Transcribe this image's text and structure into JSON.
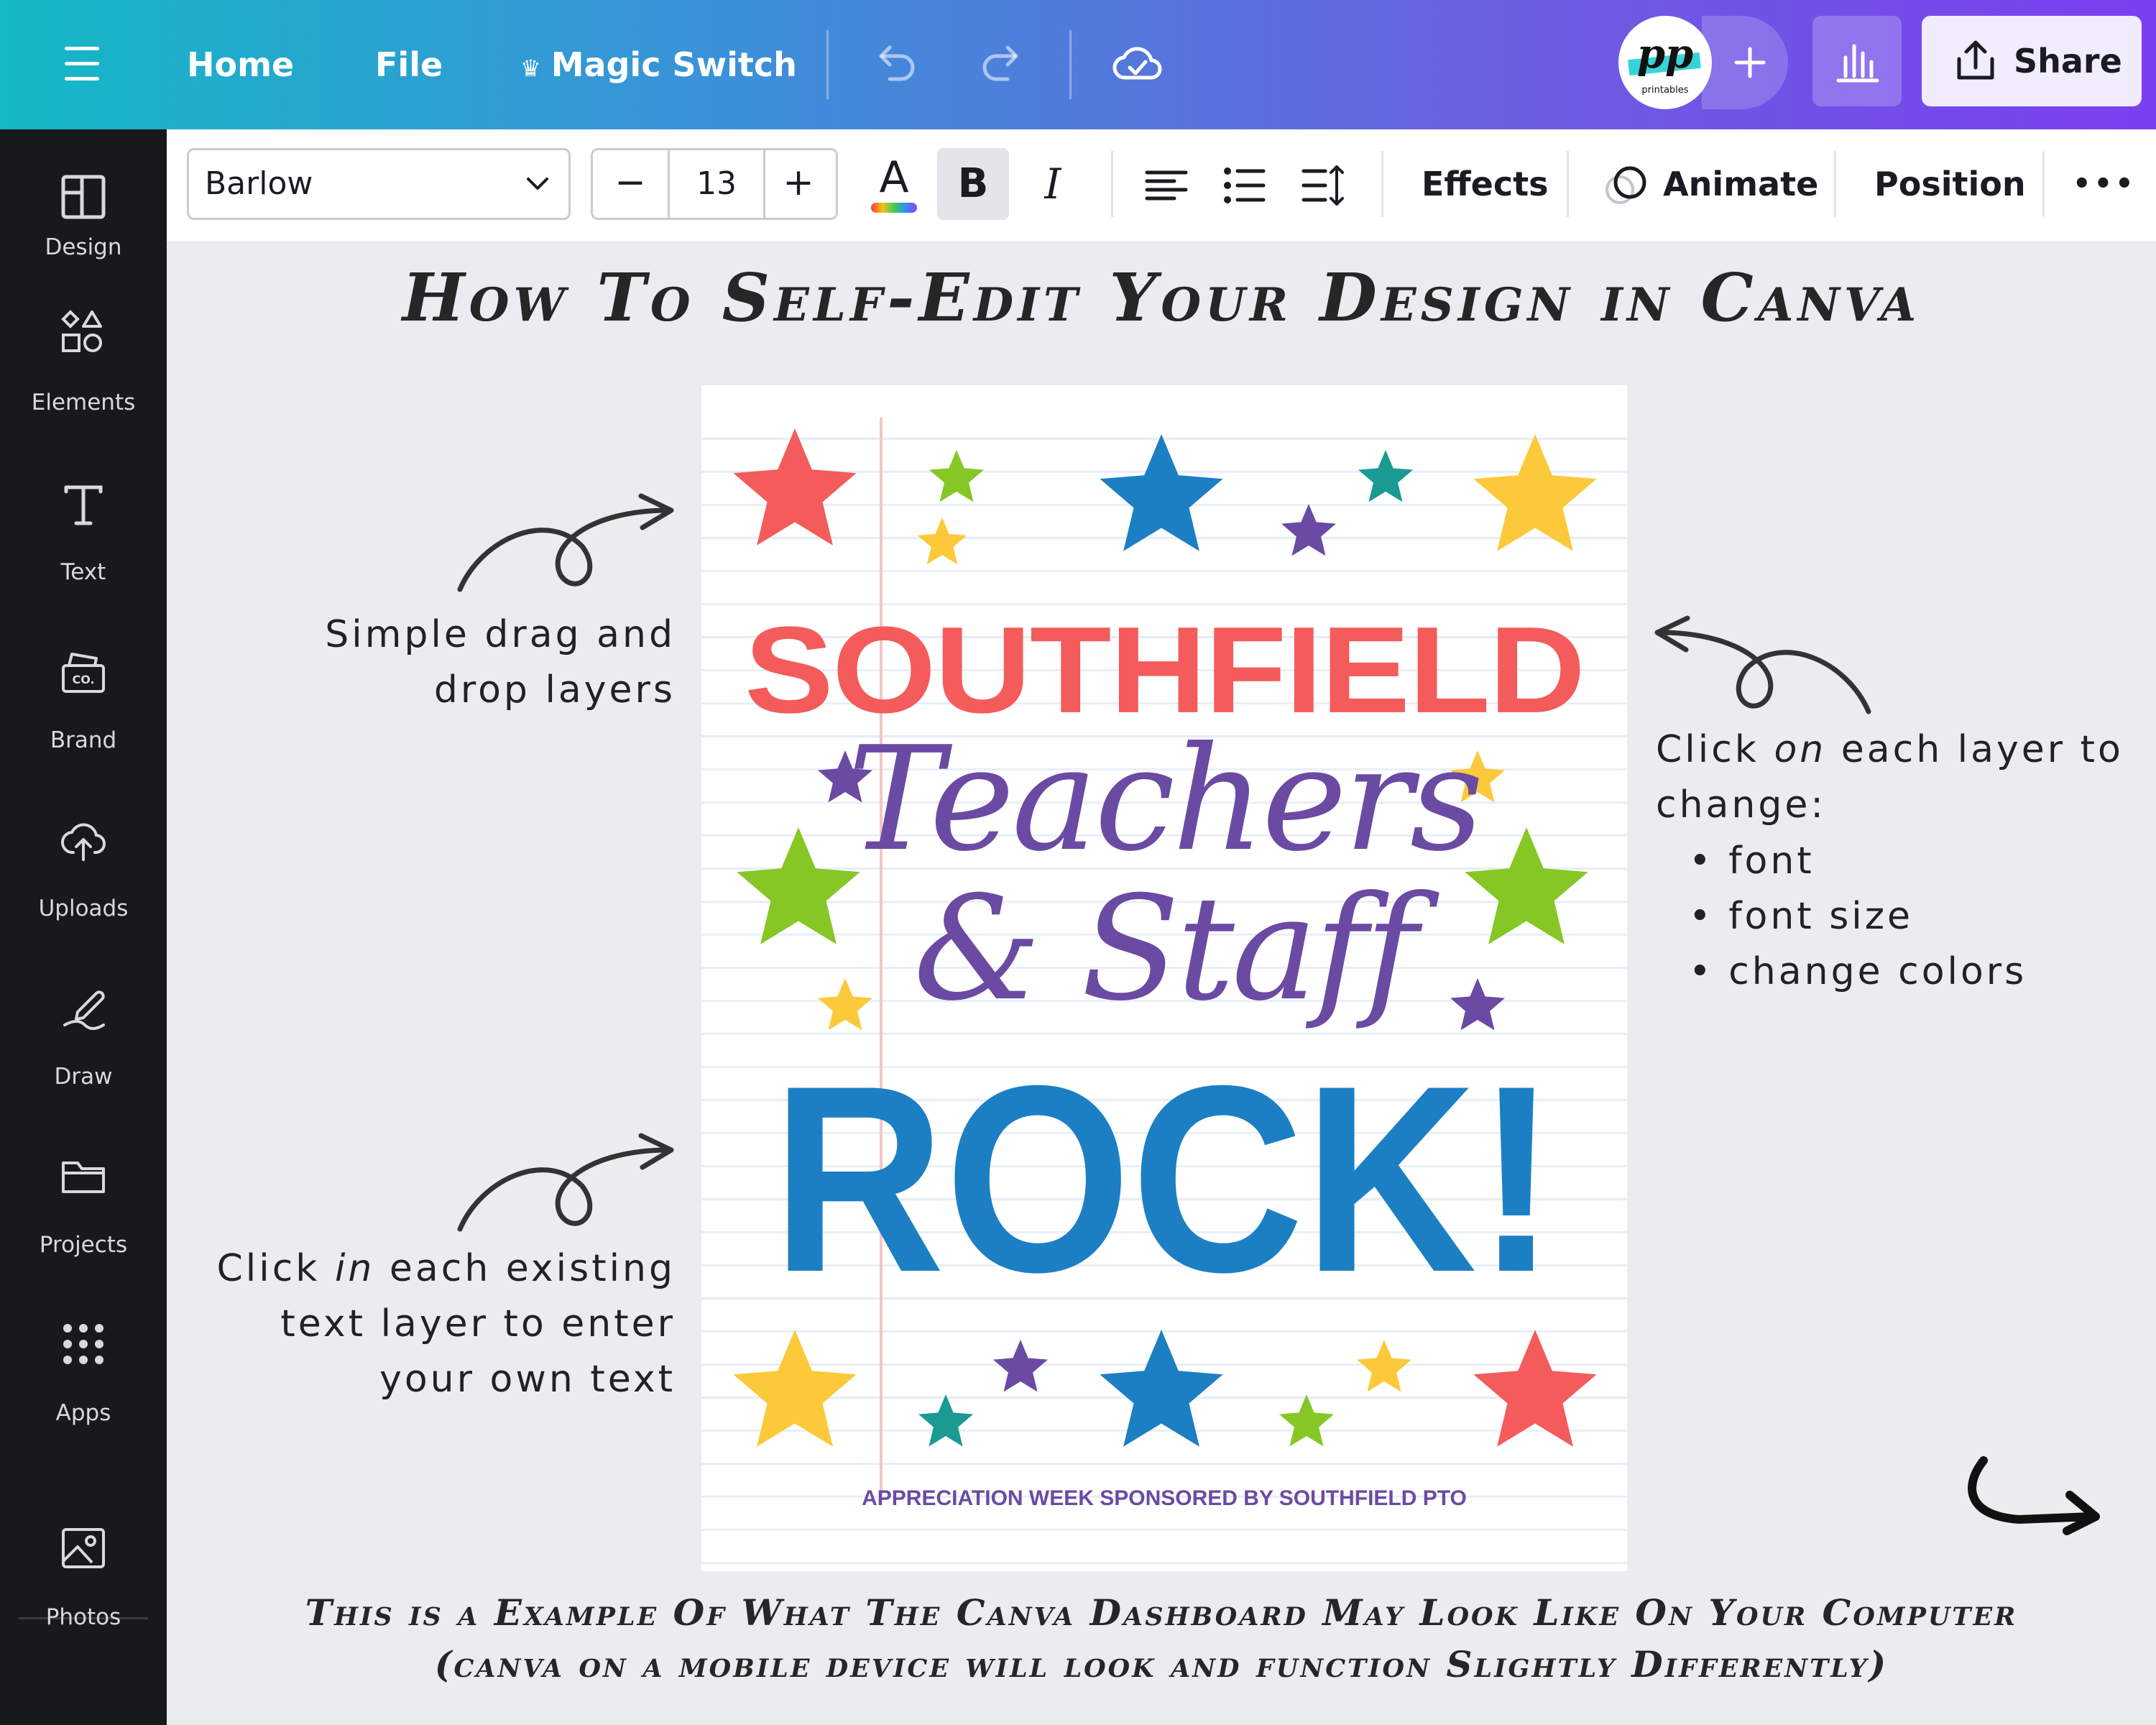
{
  "topbar": {
    "nav": [
      "Home",
      "File",
      "Magic Switch"
    ],
    "avatar_text": "pp",
    "avatar_sub": "printables",
    "share_label": "Share",
    "colors": {
      "gradient_start": "#14b8c6",
      "gradient_end": "#7a3ff0"
    }
  },
  "sidebar": {
    "items": [
      {
        "label": "Design",
        "icon": "layout-icon"
      },
      {
        "label": "Elements",
        "icon": "shapes-icon"
      },
      {
        "label": "Text",
        "icon": "text-icon"
      },
      {
        "label": "Brand",
        "icon": "brand-icon"
      },
      {
        "label": "Uploads",
        "icon": "upload-cloud-icon"
      },
      {
        "label": "Draw",
        "icon": "draw-icon"
      },
      {
        "label": "Projects",
        "icon": "folder-icon"
      },
      {
        "label": "Apps",
        "icon": "apps-grid-icon"
      },
      {
        "label": "Photos",
        "icon": "image-icon"
      }
    ]
  },
  "toolbar": {
    "font_family": "Barlow",
    "font_size": "13",
    "minus": "−",
    "plus": "+",
    "color_letter": "A",
    "bold": "B",
    "italic": "I",
    "effects": "Effects",
    "animate": "Animate",
    "position": "Position",
    "more": "•••"
  },
  "canvas": {
    "title": "How To Self-Edit Your Design in Canva",
    "annotation_drag": [
      "Simple drag and",
      "drop layers"
    ],
    "annotation_click_in": {
      "pre": "Click ",
      "em": "in",
      "post": " each existing",
      "line2": "text layer to enter",
      "line3": "your own text"
    },
    "annotation_click_on": {
      "pre": "Click ",
      "em": "on",
      "post": " each layer to",
      "line2": "change:"
    },
    "bullets": [
      "font",
      "font size",
      "change colors"
    ],
    "bottom_note_1": "This is a Example Of What The Canva Dashboard May Look Like On Your Computer",
    "bottom_note_2": "(canva on a mobile device will look and function Slightly Differently)"
  },
  "poster": {
    "line1": "SOUTHFIELD",
    "line2": "Teachers",
    "line3": "& Staff",
    "line4": "ROCK!",
    "footer": "APPRECIATION WEEK SPONSORED BY SOUTHFIELD PTO",
    "colors": {
      "red": "#f45b5b",
      "purple": "#6b4aa3",
      "blue": "#1c7fc4",
      "yellow": "#fcc93a",
      "green": "#86c726",
      "teal": "#1a9a93"
    }
  }
}
